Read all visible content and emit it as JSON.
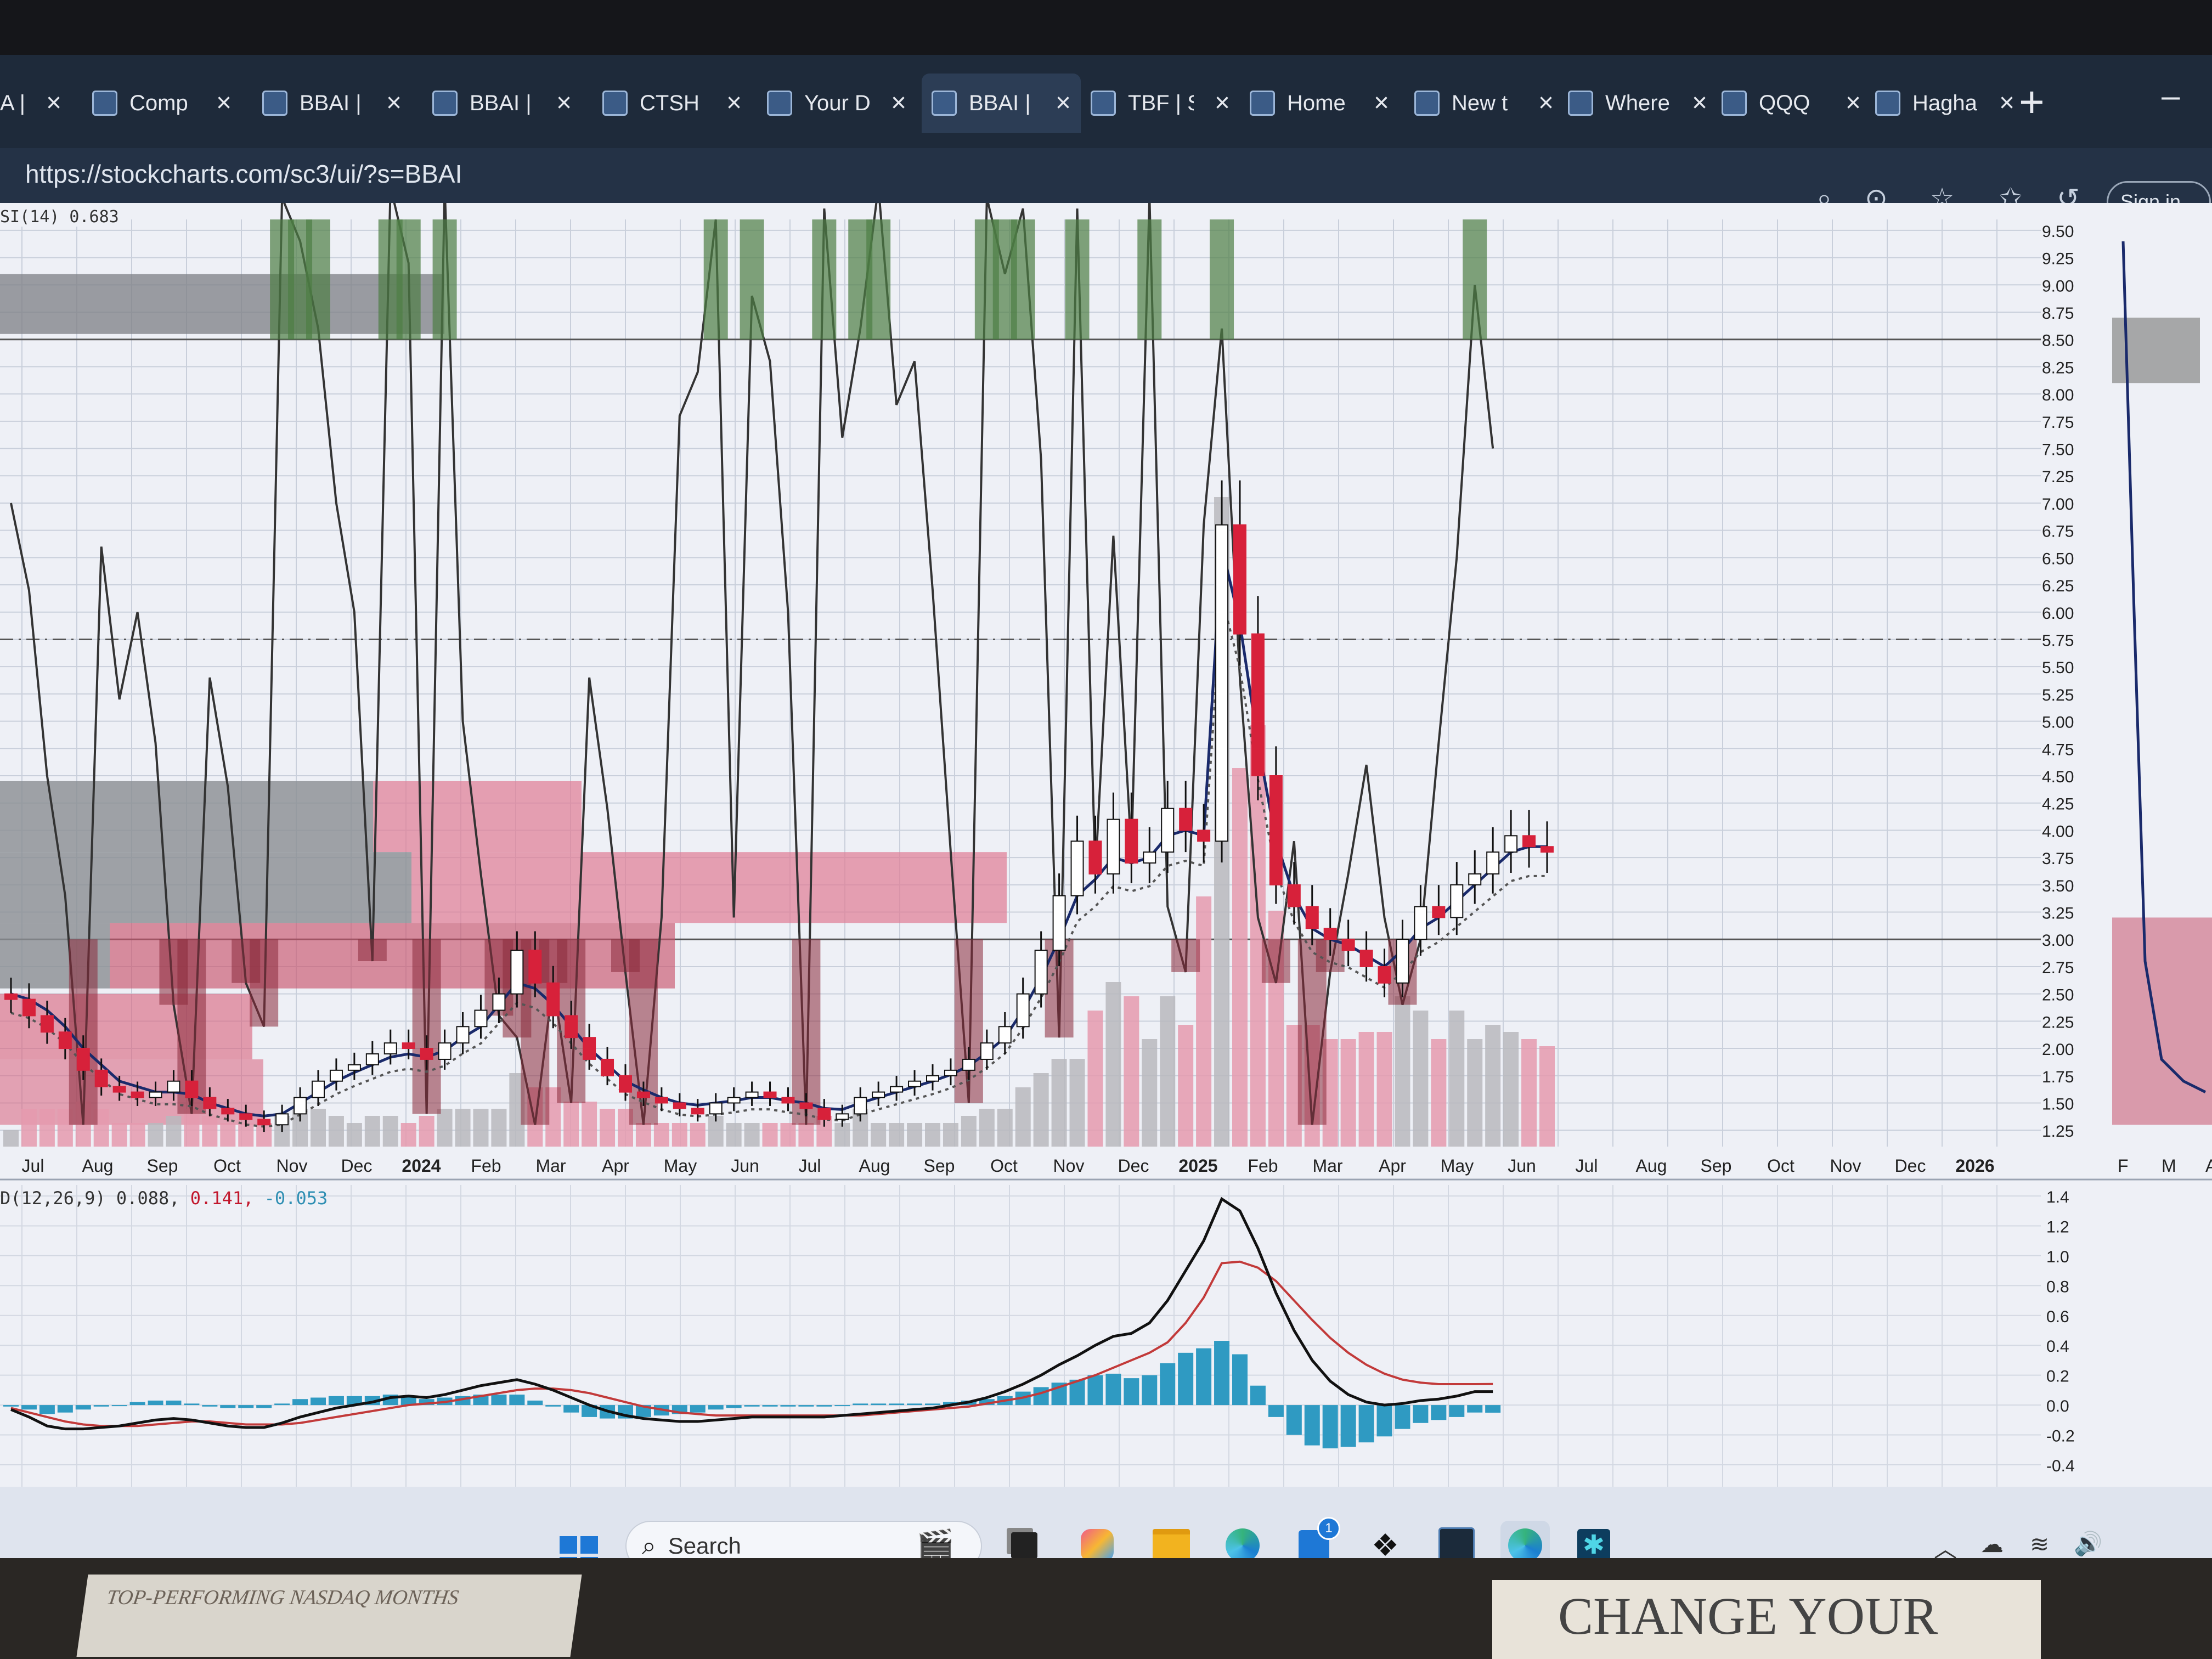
{
  "browser": {
    "tabs": [
      {
        "title": "A |",
        "icon": "ribbon-icon"
      },
      {
        "title": "Comp",
        "icon": "page-icon"
      },
      {
        "title": "BBAI |",
        "icon": "stockcharts-icon"
      },
      {
        "title": "BBAI |",
        "icon": "stockcharts-icon"
      },
      {
        "title": "CTSH",
        "icon": "stockcharts-icon"
      },
      {
        "title": "Your D",
        "icon": "stockcharts-icon"
      },
      {
        "title": "BBAI |",
        "icon": "stockcharts-icon",
        "active": true
      },
      {
        "title": "TBF | S",
        "icon": "stockcharts-icon"
      },
      {
        "title": "Home",
        "icon": "hand-icon"
      },
      {
        "title": "New t",
        "icon": "calendar-icon"
      },
      {
        "title": "Where",
        "icon": "sparkle-icon"
      },
      {
        "title": "QQQ",
        "icon": "stockcharts-icon"
      },
      {
        "title": "Hagha",
        "icon": "search-icon"
      }
    ],
    "url": "https://stockcharts.com/sc3/ui/?s=BBAI",
    "sign_in": "Sign in"
  },
  "chart": {
    "rsi_label": "SI(14) 0.683",
    "macd_label": "D(12,26,9) 0.088,",
    "macd_signal": "0.141,",
    "macd_hist": "-0.053",
    "colors": {
      "up": "#ffffff",
      "down": "#d7213a",
      "sma": "#1a2a6b",
      "rsi": "#333333",
      "macd": "#111111",
      "signal": "#c23a3a",
      "hist": "#2f9ac2"
    },
    "chart_data": {
      "type": "line",
      "price_axis": [
        "9.50",
        "9.25",
        "9.00",
        "8.75",
        "8.50",
        "8.25",
        "8.00",
        "7.75",
        "7.50",
        "7.25",
        "7.00",
        "6.75",
        "6.50",
        "6.25",
        "6.00",
        "5.75",
        "5.50",
        "5.25",
        "5.00",
        "4.75",
        "4.50",
        "4.25",
        "4.00",
        "3.75",
        "3.50",
        "3.25",
        "3.00",
        "2.75",
        "2.50",
        "2.25",
        "2.00",
        "1.75",
        "1.50",
        "1.25"
      ],
      "macd_axis": [
        "1.4",
        "1.2",
        "1.0",
        "0.8",
        "0.6",
        "0.4",
        "0.2",
        "0.0",
        "-0.2",
        "-0.4"
      ],
      "x_labels": [
        "Jul",
        "Aug",
        "Sep",
        "Oct",
        "Nov",
        "Dec",
        "2024",
        "Feb",
        "Mar",
        "Apr",
        "May",
        "Jun",
        "Jul",
        "Aug",
        "Sep",
        "Oct",
        "Nov",
        "Dec",
        "2025",
        "Feb",
        "Mar",
        "Apr",
        "May",
        "Jun",
        "Jul",
        "Aug",
        "Sep",
        "Oct",
        "Nov",
        "Dec",
        "2026"
      ],
      "x_bold": [
        "2024",
        "2025",
        "2026"
      ],
      "side_x_labels": [
        "F",
        "M",
        "A"
      ],
      "ylim": [
        1.1,
        9.6
      ],
      "close": [
        2.45,
        2.3,
        2.15,
        2.0,
        1.8,
        1.65,
        1.6,
        1.55,
        1.6,
        1.7,
        1.55,
        1.45,
        1.4,
        1.35,
        1.3,
        1.4,
        1.55,
        1.7,
        1.8,
        1.85,
        1.95,
        2.05,
        2.0,
        1.9,
        2.05,
        2.2,
        2.35,
        2.5,
        2.9,
        2.6,
        2.3,
        2.1,
        1.9,
        1.75,
        1.6,
        1.55,
        1.5,
        1.45,
        1.4,
        1.5,
        1.55,
        1.6,
        1.55,
        1.5,
        1.45,
        1.35,
        1.4,
        1.55,
        1.6,
        1.65,
        1.7,
        1.75,
        1.8,
        1.9,
        2.05,
        2.2,
        2.5,
        2.9,
        3.4,
        3.9,
        3.6,
        4.1,
        3.7,
        3.8,
        4.2,
        4.0,
        3.9,
        6.8,
        5.8,
        4.5,
        3.5,
        3.3,
        3.1,
        3.0,
        2.9,
        2.75,
        2.6,
        3.0,
        3.3,
        3.2,
        3.5,
        3.6,
        3.8,
        3.95,
        3.85,
        3.8
      ],
      "sma": [
        2.5,
        2.45,
        2.35,
        2.2,
        2.0,
        1.85,
        1.7,
        1.65,
        1.6,
        1.6,
        1.58,
        1.5,
        1.45,
        1.4,
        1.38,
        1.4,
        1.5,
        1.6,
        1.7,
        1.78,
        1.85,
        1.92,
        1.95,
        1.92,
        1.98,
        2.1,
        2.2,
        2.4,
        2.6,
        2.55,
        2.4,
        2.2,
        2.0,
        1.85,
        1.7,
        1.62,
        1.55,
        1.5,
        1.48,
        1.5,
        1.52,
        1.55,
        1.55,
        1.52,
        1.5,
        1.45,
        1.44,
        1.5,
        1.55,
        1.6,
        1.65,
        1.7,
        1.76,
        1.84,
        1.96,
        2.1,
        2.35,
        2.65,
        3.0,
        3.4,
        3.55,
        3.75,
        3.7,
        3.75,
        3.95,
        4.0,
        3.95,
        6.6,
        5.9,
        4.8,
        3.9,
        3.4,
        3.1,
        3.0,
        2.95,
        2.85,
        2.75,
        2.9,
        3.1,
        3.2,
        3.35,
        3.5,
        3.65,
        3.8,
        3.85,
        3.85
      ],
      "rsi": [
        7.0,
        6.2,
        4.5,
        3.4,
        1.3,
        6.6,
        5.2,
        6.0,
        4.8,
        2.4,
        1.4,
        5.4,
        4.4,
        2.6,
        2.2,
        9.8,
        9.4,
        8.6,
        7.0,
        6.0,
        2.8,
        9.9,
        9.2,
        1.4,
        9.9,
        5.0,
        3.6,
        2.3,
        2.1,
        1.3,
        2.6,
        1.5,
        5.4,
        4.2,
        2.7,
        1.3,
        3.2,
        7.8,
        8.2,
        9.6,
        3.2,
        8.9,
        8.3,
        6.0,
        1.3,
        9.7,
        7.6,
        8.6,
        9.9,
        7.9,
        8.3,
        6.2,
        3.8,
        1.5,
        9.8,
        9.1,
        9.7,
        7.4,
        2.1,
        9.7,
        3.6,
        6.7,
        3.8,
        9.8,
        3.3,
        2.7,
        6.8,
        8.6,
        5.4,
        3.2,
        2.6,
        3.9,
        1.3,
        2.7,
        3.6,
        4.6,
        3.2,
        2.4,
        3.0,
        4.8,
        6.5,
        9.0,
        7.5
      ],
      "macd": [
        -0.03,
        -0.08,
        -0.14,
        -0.16,
        -0.16,
        -0.15,
        -0.14,
        -0.12,
        -0.1,
        -0.09,
        -0.1,
        -0.12,
        -0.14,
        -0.15,
        -0.15,
        -0.12,
        -0.08,
        -0.05,
        -0.02,
        0.0,
        0.02,
        0.05,
        0.06,
        0.05,
        0.07,
        0.1,
        0.13,
        0.15,
        0.17,
        0.14,
        0.1,
        0.05,
        0.0,
        -0.04,
        -0.07,
        -0.09,
        -0.1,
        -0.11,
        -0.11,
        -0.1,
        -0.09,
        -0.08,
        -0.08,
        -0.08,
        -0.08,
        -0.08,
        -0.07,
        -0.06,
        -0.05,
        -0.04,
        -0.03,
        -0.02,
        0.0,
        0.02,
        0.05,
        0.09,
        0.14,
        0.2,
        0.27,
        0.33,
        0.4,
        0.46,
        0.48,
        0.55,
        0.7,
        0.9,
        1.1,
        1.38,
        1.3,
        1.05,
        0.75,
        0.5,
        0.3,
        0.16,
        0.07,
        0.02,
        0.0,
        0.01,
        0.03,
        0.04,
        0.06,
        0.09,
        0.09
      ],
      "signal": [
        -0.02,
        -0.05,
        -0.08,
        -0.11,
        -0.13,
        -0.14,
        -0.14,
        -0.14,
        -0.13,
        -0.12,
        -0.11,
        -0.11,
        -0.12,
        -0.13,
        -0.13,
        -0.13,
        -0.12,
        -0.1,
        -0.08,
        -0.06,
        -0.04,
        -0.02,
        0.0,
        0.01,
        0.02,
        0.04,
        0.06,
        0.08,
        0.1,
        0.11,
        0.11,
        0.1,
        0.08,
        0.05,
        0.02,
        -0.01,
        -0.03,
        -0.05,
        -0.06,
        -0.07,
        -0.07,
        -0.07,
        -0.07,
        -0.07,
        -0.07,
        -0.07,
        -0.07,
        -0.07,
        -0.06,
        -0.05,
        -0.04,
        -0.03,
        -0.02,
        -0.01,
        0.01,
        0.03,
        0.05,
        0.08,
        0.12,
        0.16,
        0.2,
        0.25,
        0.3,
        0.35,
        0.42,
        0.55,
        0.72,
        0.95,
        0.96,
        0.92,
        0.83,
        0.7,
        0.57,
        0.45,
        0.35,
        0.27,
        0.21,
        0.17,
        0.15,
        0.14,
        0.14,
        0.14,
        0.141
      ]
    }
  },
  "taskbar": {
    "search_label": "Search",
    "apps": [
      "clapper-icon",
      "task-view-icon",
      "copilot-icon",
      "folder-icon",
      "edge-icon",
      "store-icon",
      "dropbox-icon",
      "terminal-icon",
      "edge-active-icon",
      "snip-icon"
    ],
    "store_badge": "1"
  },
  "desk": {
    "paper_text": "TOP-PERFORMING NASDAQ MONTHS",
    "paper2_text": "CHANGE YOUR"
  }
}
